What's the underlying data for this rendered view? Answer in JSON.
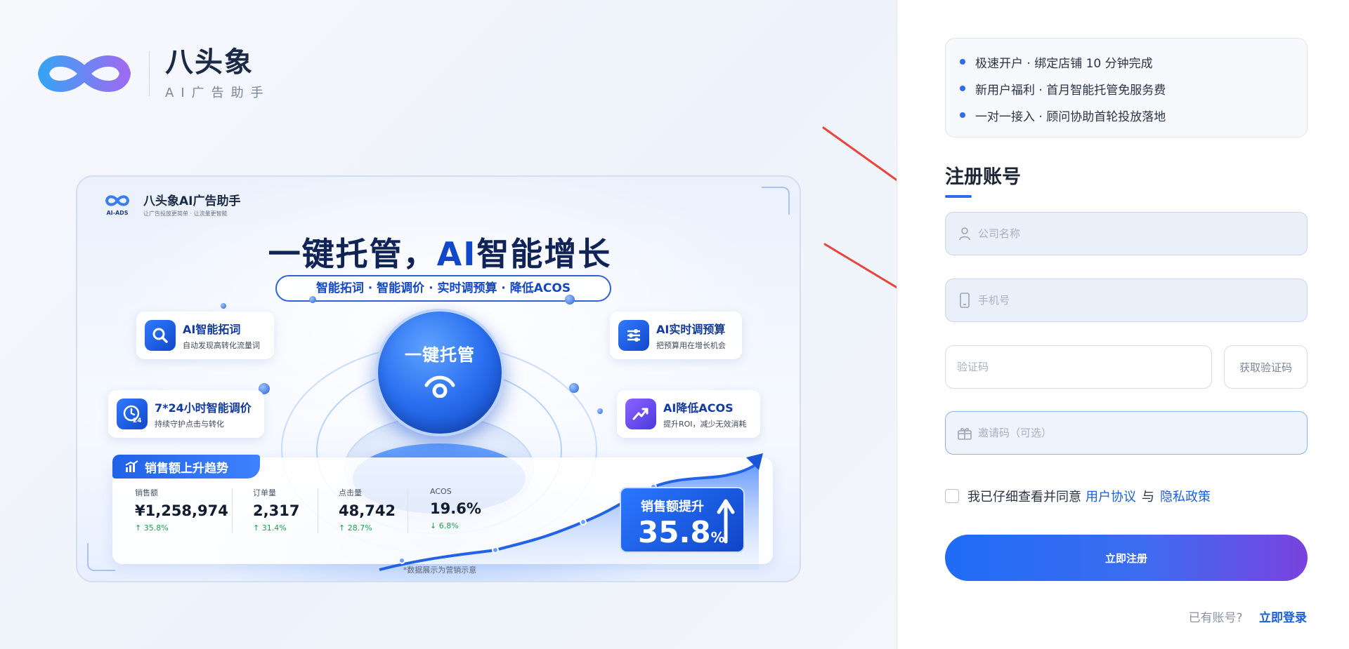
{
  "brand": {
    "name": "八头象",
    "subtitle": "AI广告助手"
  },
  "poster": {
    "logo_text": "AI-ADS",
    "title": "八头象AI广告助手",
    "slogan": "让广告投放更简单 · 让流量更智能",
    "headline_prefix": "一键托管，",
    "headline_ai": "AI",
    "headline_suffix": "智能增长",
    "features_line": "智能拓词  ·  智能调价  ·  实时调预算  ·  降低ACOS",
    "center_button": "一键托管",
    "features": [
      {
        "title": "AI智能拓词",
        "desc": "自动发现高转化流量词",
        "icon": "search-icon"
      },
      {
        "title": "AI实时调预算",
        "desc": "把预算用在增长机会",
        "icon": "sliders-icon"
      },
      {
        "title": "7*24小时智能调价",
        "desc": "持续守护点击与转化",
        "icon": "clock-24-icon"
      },
      {
        "title": "AI降低ACOS",
        "desc": "提升ROI，减少无效消耗",
        "icon": "trend-up-icon"
      }
    ],
    "trend_title": "销售额上升趋势",
    "metrics": [
      {
        "label": "销售额",
        "value": "¥1,258,974",
        "change": "↑ 35.8%",
        "direction": "up"
      },
      {
        "label": "订单量",
        "value": "2,317",
        "change": "↑ 31.4%",
        "direction": "up"
      },
      {
        "label": "点击量",
        "value": "48,742",
        "change": "↑ 28.7%",
        "direction": "up"
      },
      {
        "label": "ACOS",
        "value": "19.6%",
        "change": "↓ 6.8%",
        "direction": "down"
      }
    ],
    "growth_label": "销售额提升",
    "growth_value": "35.8",
    "growth_unit": "%",
    "note": "*数据展示为营销示意"
  },
  "register": {
    "benefits": [
      "极速开户 · 绑定店铺 10 分钟完成",
      "新用户福利 · 首月智能托管免服务费",
      "一对一接入 · 顾问协助首轮投放落地"
    ],
    "title": "注册账号",
    "company_placeholder": "公司名称",
    "phone_placeholder": "手机号",
    "code_placeholder": "验证码",
    "get_code_label": "获取验证码",
    "invite_placeholder": "邀请码（可选）",
    "agree_prefix": "我已仔细查看并同意",
    "agree_user_link": "用户协议",
    "agree_mid": "与",
    "agree_privacy_link": "隐私政策",
    "submit_label": "立即注册",
    "have_account": "已有账号?",
    "login_link": "立即登录"
  },
  "colors": {
    "accent": "#1f6cf6",
    "accent_purple": "#7a42df",
    "annotation_arrow": "#e8453c",
    "positive": "#1f9d4b",
    "negative": "#1f9d4b"
  }
}
